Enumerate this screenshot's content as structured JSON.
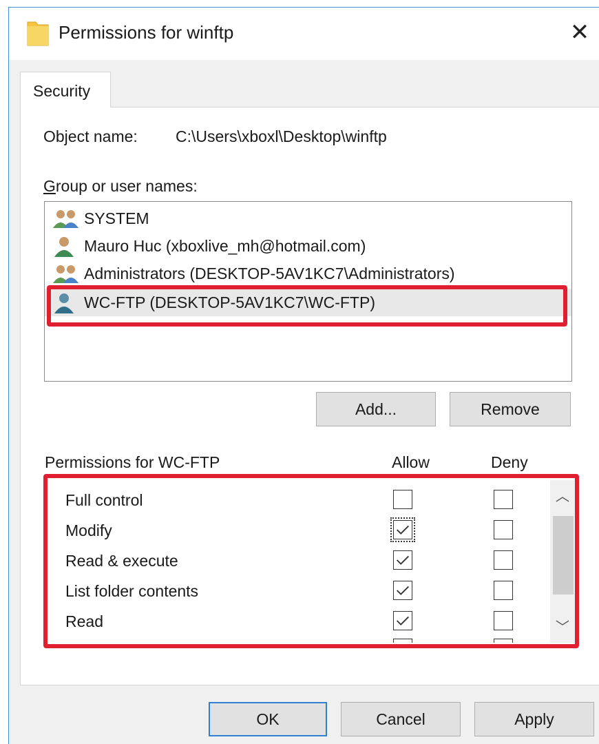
{
  "window": {
    "title": "Permissions for winftp",
    "close": "✕"
  },
  "tabs": [
    {
      "label": "Security"
    }
  ],
  "object": {
    "label": "Object name:",
    "value": "C:\\Users\\xboxl\\Desktop\\winftp"
  },
  "groups": {
    "label": "Group or user names:",
    "items": [
      {
        "name": "SYSTEM",
        "icon": "group-users-icon"
      },
      {
        "name": "Mauro Huc (xboxlive_mh@hotmail.com)",
        "icon": "user-icon"
      },
      {
        "name": "Administrators (DESKTOP-5AV1KC7\\Administrators)",
        "icon": "group-users-icon"
      },
      {
        "name": "WC-FTP (DESKTOP-5AV1KC7\\WC-FTP)",
        "icon": "user-icon",
        "selected": true
      }
    ]
  },
  "buttons": {
    "add": "Add...",
    "remove": "Remove",
    "ok": "OK",
    "cancel": "Cancel",
    "apply": "Apply"
  },
  "permissions": {
    "label": "Permissions for WC-FTP",
    "allow_header": "Allow",
    "deny_header": "Deny",
    "rows": [
      {
        "name": "Full control",
        "allow": false,
        "deny": false
      },
      {
        "name": "Modify",
        "allow": true,
        "deny": false
      },
      {
        "name": "Read & execute",
        "allow": true,
        "deny": false
      },
      {
        "name": "List folder contents",
        "allow": true,
        "deny": false
      },
      {
        "name": "Read",
        "allow": true,
        "deny": false
      }
    ]
  },
  "colors": {
    "highlight": "#e02030",
    "accent": "#2f7fd3",
    "folder": "#f5c542"
  }
}
